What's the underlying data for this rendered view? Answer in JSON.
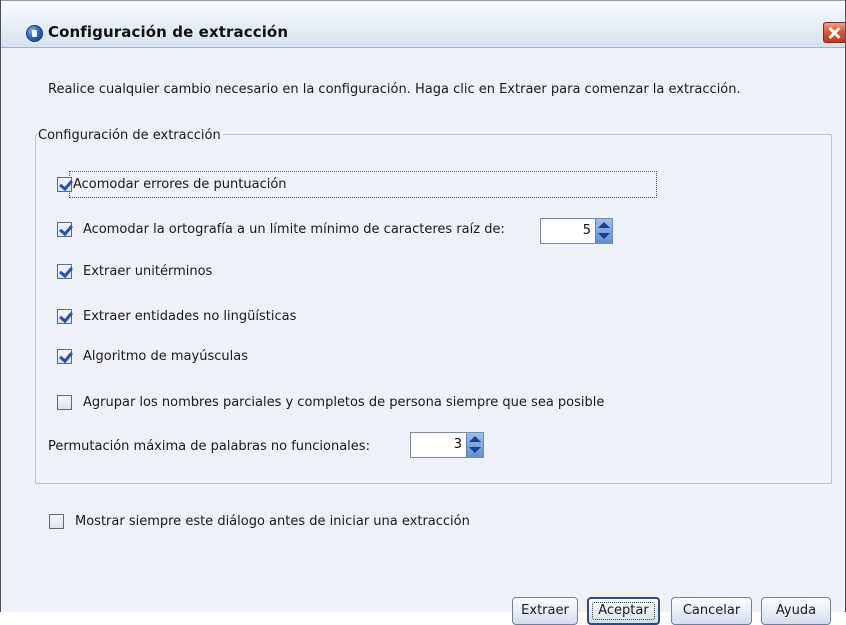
{
  "window": {
    "title": "Configuración de extracción",
    "icon": "info-icon",
    "close_icon": "close-icon"
  },
  "intro_text": "Realice cualquier cambio necesario en la configuración.  Haga clic en Extraer para comenzar la extracción.",
  "group": {
    "legend": "Configuración de extracción",
    "options": [
      {
        "label": "Acomodar errores de puntuación",
        "checked": true
      },
      {
        "label": "Acomodar la ortografía a un límite mínimo de caracteres raíz de:",
        "checked": true
      },
      {
        "label": "Extraer unitérminos",
        "checked": true
      },
      {
        "label": "Extraer entidades no lingüísticas",
        "checked": true
      },
      {
        "label": "Algoritmo de mayúsculas",
        "checked": true
      },
      {
        "label": "Agrupar los nombres parciales y completos de persona siempre que sea posible",
        "checked": false
      }
    ],
    "min_root_chars": "5",
    "permutation_label": "Permutación máxima de palabras no funcionales:",
    "permutation_value": "3"
  },
  "always_show": {
    "label": "Mostrar siempre este diálogo antes de iniciar una extracción",
    "checked": false
  },
  "buttons": {
    "extract": "Extraer",
    "ok": "Aceptar",
    "cancel": "Cancelar",
    "help": "Ayuda"
  },
  "colors": {
    "dialog_background": "#eef2f8",
    "checkmark": "#2a4fb4",
    "spinner_arrows": "#5c8fd9",
    "close_button": "#dd5638"
  }
}
